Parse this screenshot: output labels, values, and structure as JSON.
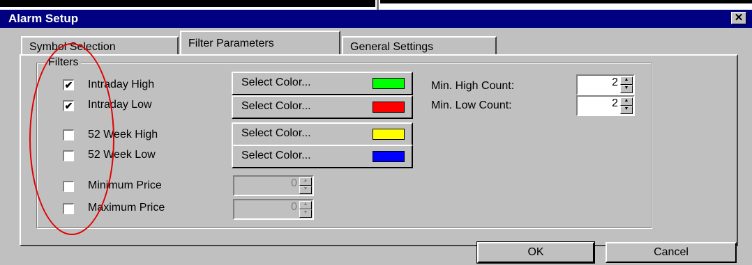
{
  "window": {
    "title": "Alarm Setup",
    "close_glyph": "✕"
  },
  "tabs": [
    {
      "label": "Symbol Selection"
    },
    {
      "label": "Filter Parameters"
    },
    {
      "label": "General Settings"
    }
  ],
  "filters": {
    "group_label": "Filters",
    "items": [
      {
        "label": "Intraday High",
        "checked": true,
        "check_glyph": "✔"
      },
      {
        "label": "Intraday Low",
        "checked": true,
        "check_glyph": "✔"
      },
      {
        "label": "52 Week High",
        "checked": false
      },
      {
        "label": "52 Week Low",
        "checked": false
      },
      {
        "label": "Minimum Price",
        "checked": false
      },
      {
        "label": "Maximum Price",
        "checked": false
      }
    ],
    "color_buttons": [
      {
        "label": "Select Color...",
        "color": "#00ff00"
      },
      {
        "label": "Select Color...",
        "color": "#ff0000"
      },
      {
        "label": "Select Color...",
        "color": "#ffff00"
      },
      {
        "label": "Select Color...",
        "color": "#0000ff"
      }
    ],
    "min_price_value": "0",
    "max_price_value": "0"
  },
  "counts": {
    "high_label": "Min. High Count:",
    "high_value": "2",
    "low_label": "Min. Low Count:",
    "low_value": "2"
  },
  "buttons": {
    "ok": "OK",
    "cancel": "Cancel"
  },
  "annotation": {
    "color": "#e00000"
  }
}
